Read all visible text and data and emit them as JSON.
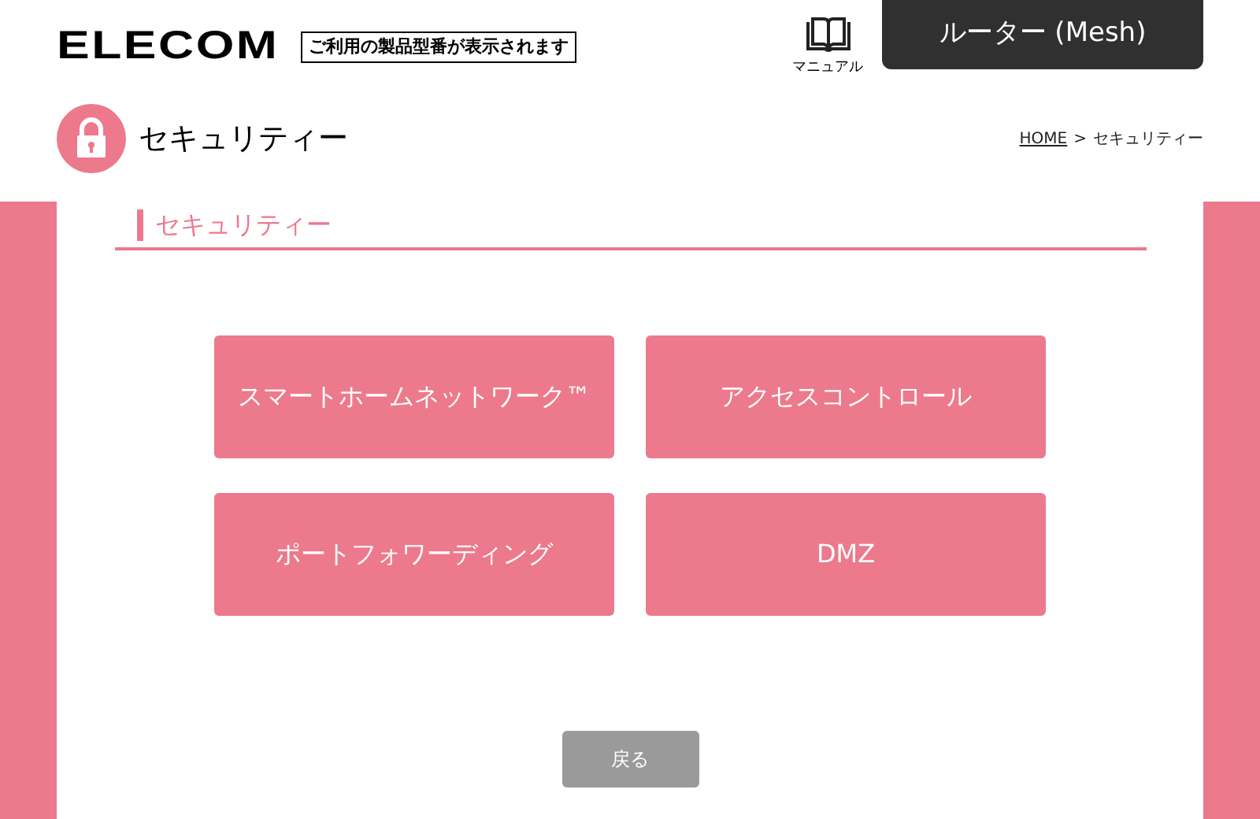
{
  "header": {
    "logo": "ELECOM",
    "model_notice": "ご利用の製品型番が表示されます",
    "manual_label": "マニュアル",
    "product": "ルーター (Mesh)"
  },
  "page": {
    "title": "セキュリティー",
    "breadcrumb": [
      {
        "label": "HOME",
        "link": true
      },
      {
        "label": ">",
        "link": false
      },
      {
        "label": "セキュリティー",
        "link": false
      }
    ]
  },
  "section": {
    "heading": "セキュリティー"
  },
  "menu_buttons": [
    {
      "label": "スマートホームネットワーク™"
    },
    {
      "label": "アクセスコントロール"
    },
    {
      "label": "ポートフォワーディング"
    },
    {
      "label": "DMZ"
    }
  ],
  "back_button": {
    "label": "戻る",
    "disabled": true
  }
}
